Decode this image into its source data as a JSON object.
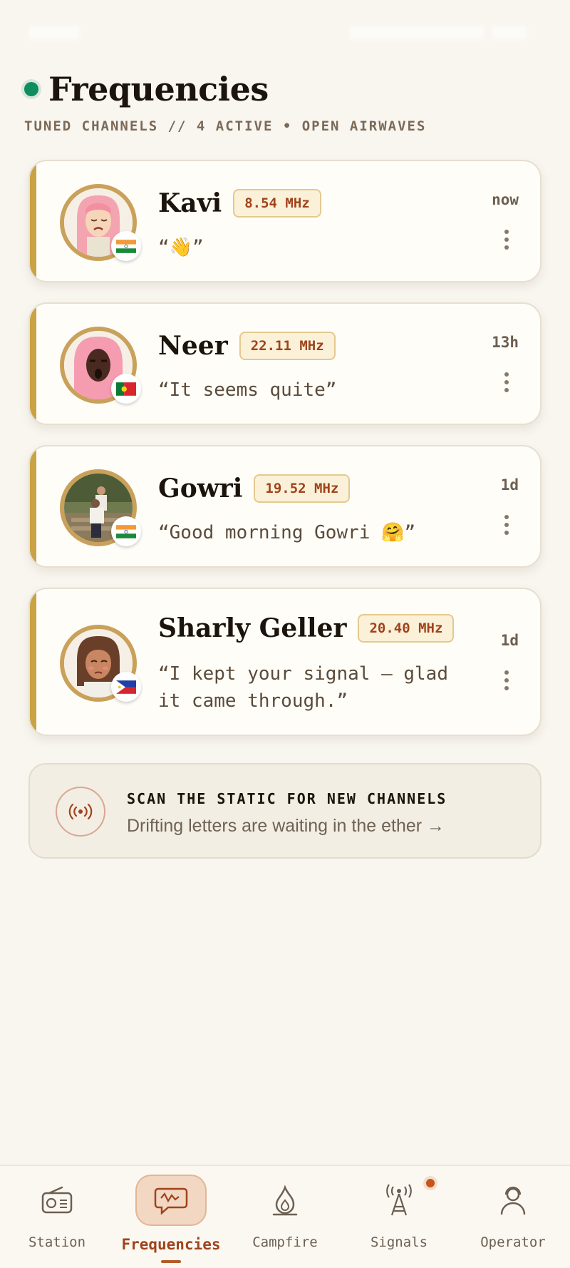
{
  "header": {
    "title": "Frequencies",
    "subtitle": "TUNED CHANNELS // 4 ACTIVE • OPEN AIRWAVES"
  },
  "channels": [
    {
      "name": "Kavi",
      "frequency": "8.54 MHz",
      "message": "“👋”",
      "time": "now",
      "flag": "india-flag"
    },
    {
      "name": "Neer",
      "frequency": "22.11 MHz",
      "message": "“It seems quite”",
      "time": "13h",
      "flag": "portugal-flag"
    },
    {
      "name": "Gowri",
      "frequency": "19.52 MHz",
      "message": "“Good morning Gowri 🤗”",
      "time": "1d",
      "flag": "india-flag"
    },
    {
      "name": "Sharly Geller",
      "frequency": "20.40 MHz",
      "message_line1": "“I kept your signal — glad",
      "message_line2": "it came through.”",
      "time": "1d",
      "flag": "philippines-flag"
    }
  ],
  "scan": {
    "title": "SCAN THE STATIC FOR NEW CHANNELS",
    "subtitle": "Drifting letters are waiting in the ether →"
  },
  "tabs": [
    {
      "label": "Station",
      "icon": "radio-icon"
    },
    {
      "label": "Frequencies",
      "icon": "chat-bubble-icon",
      "active": true
    },
    {
      "label": "Campfire",
      "icon": "flame-icon"
    },
    {
      "label": "Signals",
      "icon": "antenna-tower-icon",
      "badge": true
    },
    {
      "label": "Operator",
      "icon": "person-icon"
    }
  ],
  "colors": {
    "background": "#f9f6f0",
    "accent_gold": "#c9a243",
    "frequency_text": "#a0431c",
    "live_dot": "#0e8e5f",
    "active_tab": "#a0431c"
  }
}
